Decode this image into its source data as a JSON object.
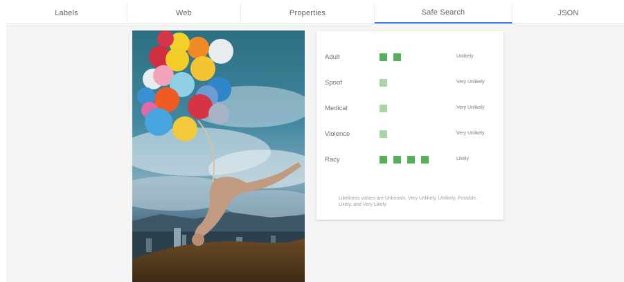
{
  "tabs": [
    {
      "label": "Labels"
    },
    {
      "label": "Web"
    },
    {
      "label": "Properties"
    },
    {
      "label": "Safe Search"
    },
    {
      "label": "JSON"
    }
  ],
  "active_tab": "Safe Search",
  "safe_search": {
    "rows": [
      {
        "label": "Adult",
        "likelihood": "Unlikely",
        "level": 2
      },
      {
        "label": "Spoof",
        "likelihood": "Very Unlikely",
        "level": 1
      },
      {
        "label": "Medical",
        "likelihood": "Very Unlikely",
        "level": 1
      },
      {
        "label": "Violence",
        "likelihood": "Very Unlikely",
        "level": 1
      },
      {
        "label": "Racy",
        "likelihood": "Likely",
        "level": 4
      }
    ],
    "note": "Likeliness values are Unknown, Very Unlikely, Unlikely, Possible, Likely, and Very Likely"
  },
  "colors": {
    "accent": "#3b78e7",
    "bar_dark": "#56b05a",
    "bar_light": "#a7d6a4",
    "background": "#f4f4f4"
  },
  "image": {
    "subject": "surreal photo: nude figure hanging upside down from colorful balloons over a city"
  }
}
